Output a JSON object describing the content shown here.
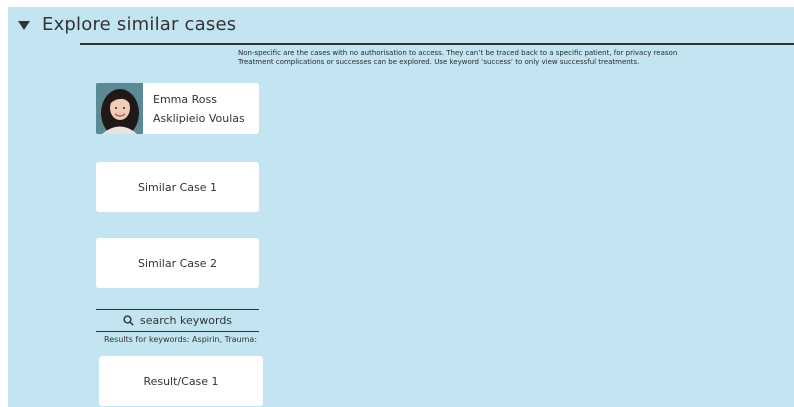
{
  "section": {
    "title": "Explore similar cases",
    "note_line1": "Non-specific are the cases with no authorisation to access. They can’t be traced back to a specific patient, for privacy reason",
    "note_line2": "Treatment complications or successes can be explored. Use keyword ‘success’ to only view successful treatments."
  },
  "profile": {
    "name": "Emma Ross",
    "hospital": "Asklipieio Voulas"
  },
  "similar_cases": [
    {
      "label": "Similar Case 1"
    },
    {
      "label": "Similar Case 2"
    }
  ],
  "search": {
    "icon": "search-icon",
    "placeholder": "search keywords",
    "results_label": "Results for keywords: Aspirin, Trauma:"
  },
  "results": [
    {
      "label": "Result/Case 1"
    }
  ],
  "colors": {
    "panel_bg": "#c3e5f1",
    "card_bg": "#ffffff",
    "text": "#333333"
  }
}
